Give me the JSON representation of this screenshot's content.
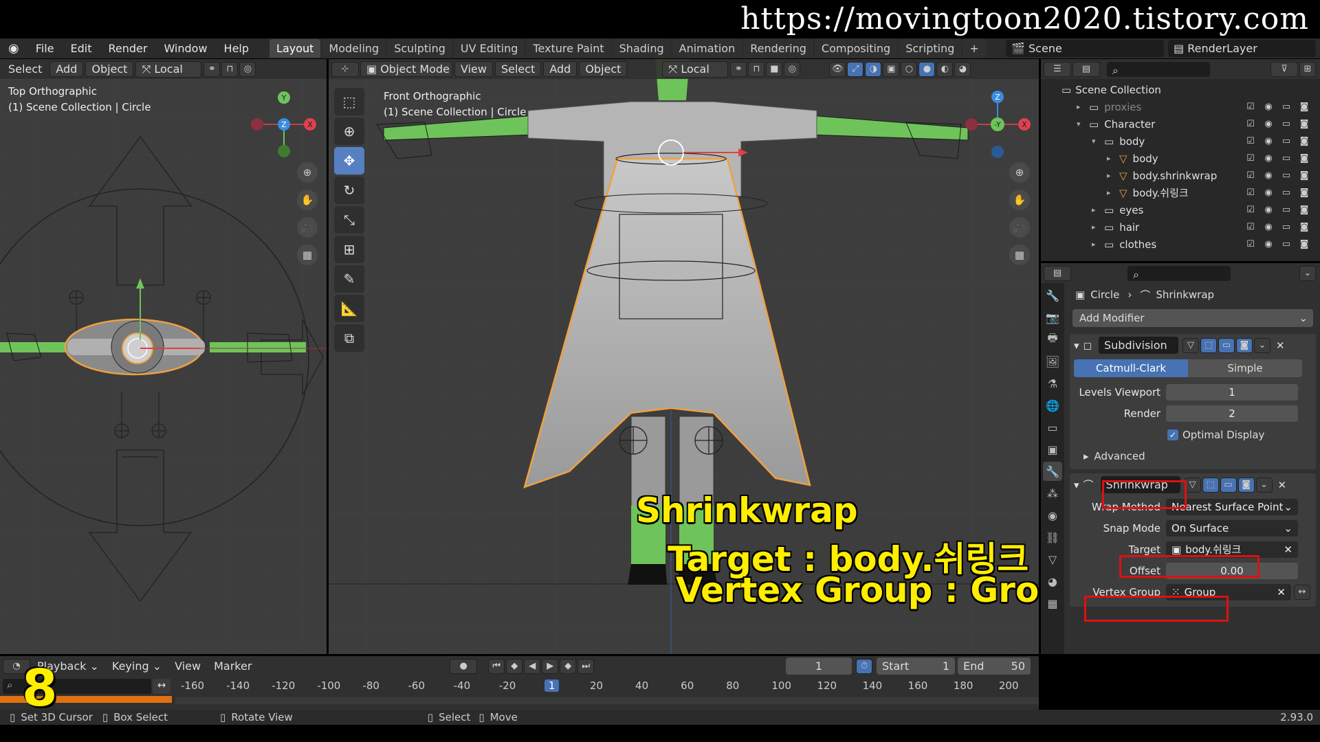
{
  "watermark": "https://movingtoon2020.tistory.com",
  "menu": [
    "File",
    "Edit",
    "Render",
    "Window",
    "Help"
  ],
  "workspace_tabs": [
    "Layout",
    "Modeling",
    "Sculpting",
    "UV Editing",
    "Texture Paint",
    "Shading",
    "Animation",
    "Rendering",
    "Compositing",
    "Scripting"
  ],
  "active_tab": "Layout",
  "scene": "Scene",
  "render_layer": "RenderLayer",
  "left_view": {
    "header": [
      "Select",
      "Add",
      "Object"
    ],
    "transform": "Local",
    "label_line1": "Top Orthographic",
    "label_line2": "(1) Scene Collection | Circle"
  },
  "main_view": {
    "mode": "Object Mode",
    "menus": [
      "View",
      "Select",
      "Add",
      "Object"
    ],
    "transform": "Local",
    "label_line1": "Front Orthographic",
    "label_line2": "(1) Scene Collection | Circle"
  },
  "overlay": {
    "line1": "Shrinkwrap",
    "line2": "Target : body.쉬링크",
    "line3": "Vertex Group : Group",
    "step": "8"
  },
  "outliner": {
    "root": "Scene Collection",
    "rows": [
      {
        "label": "proxies",
        "indent": 1
      },
      {
        "label": "Character",
        "indent": 1
      },
      {
        "label": "body",
        "indent": 2
      },
      {
        "label": "body",
        "indent": 3
      },
      {
        "label": "body.shrinkwrap",
        "indent": 3
      },
      {
        "label": "body.쉬링크",
        "indent": 3
      },
      {
        "label": "eyes",
        "indent": 2
      },
      {
        "label": "hair",
        "indent": 2
      },
      {
        "label": "clothes",
        "indent": 2
      }
    ]
  },
  "properties": {
    "breadcrumb_object": "Circle",
    "breadcrumb_modifier": "Shrinkwrap",
    "add_modifier": "Add Modifier",
    "subdivision": {
      "name": "Subdivision",
      "mode_a": "Catmull-Clark",
      "mode_b": "Simple",
      "levels_viewport_label": "Levels Viewport",
      "levels_viewport": "1",
      "render_label": "Render",
      "render": "2",
      "optimal_display": "Optimal Display",
      "advanced": "Advanced"
    },
    "shrinkwrap": {
      "name": "Shrinkwrap",
      "wrap_method_label": "Wrap Method",
      "wrap_method": "Nearest Surface Point",
      "snap_mode_label": "Snap Mode",
      "snap_mode": "On Surface",
      "target_label": "Target",
      "target": "body.쉬링크",
      "offset_label": "Offset",
      "offset": "0.00",
      "vertex_group_label": "Vertex Group",
      "vertex_group": "Group"
    }
  },
  "timeline": {
    "menus": [
      "Playback",
      "Keying",
      "View",
      "Marker"
    ],
    "current_frame": "1",
    "start_label": "Start",
    "start": "1",
    "end_label": "End",
    "end": "50",
    "ticks": [
      "-160",
      "-140",
      "-120",
      "-100",
      "-80",
      "-60",
      "-40",
      "-20",
      "1",
      "20",
      "40",
      "60",
      "80",
      "100",
      "120",
      "140",
      "160",
      "180",
      "200"
    ]
  },
  "statusbar": {
    "items": [
      "Set 3D Cursor",
      "Box Select",
      "Rotate View",
      "Select",
      "Move"
    ],
    "version": "2.93.0"
  }
}
